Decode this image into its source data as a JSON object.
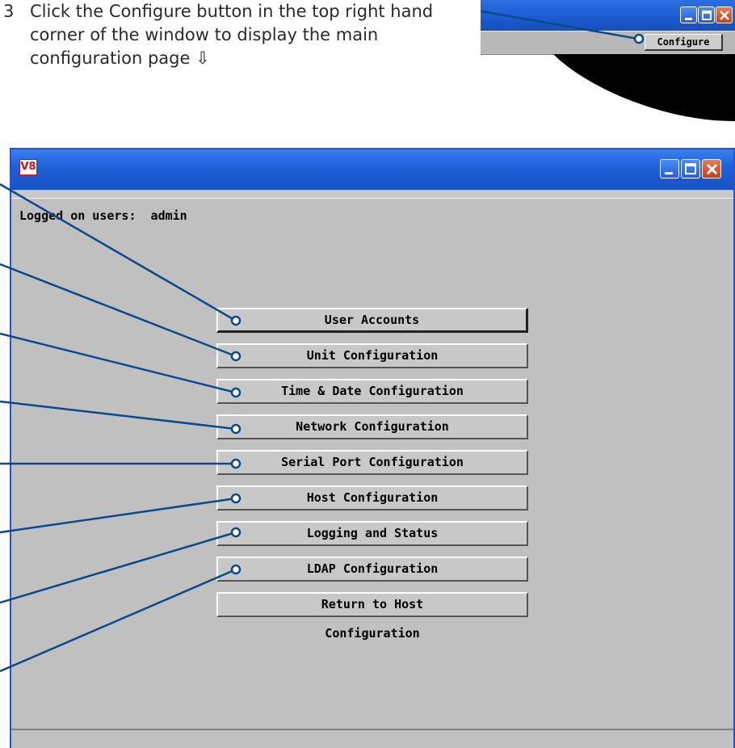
{
  "instruction": {
    "step_number": "3",
    "text": "Click the Configure button in the top right hand corner of the window to display the main configuration page ⇩"
  },
  "inset": {
    "configure_label": "Configure"
  },
  "window": {
    "logo_text": "V8",
    "logged_on_label": "Logged on users:  admin",
    "menu_buttons": [
      "User Accounts",
      "Unit Configuration",
      "Time & Date Configuration",
      "Network Configuration",
      "Serial Port Configuration",
      "Host Configuration",
      "Logging and Status",
      "LDAP Configuration",
      "Return to Host"
    ],
    "page_label": "Configuration"
  },
  "colors": {
    "callout_line": "#0a4a8c",
    "titlebar": "#1f60d8",
    "window_bg": "#c0c0c0",
    "logo_red": "#c21818"
  }
}
